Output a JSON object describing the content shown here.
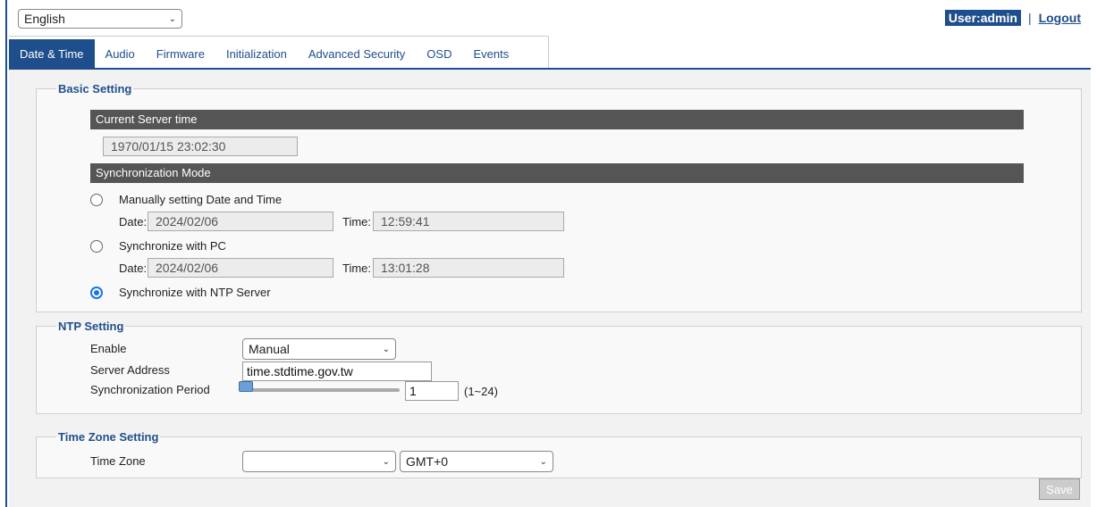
{
  "header": {
    "language": "English",
    "user_label": "User:admin",
    "separator": "|",
    "logout_label": "Logout"
  },
  "tabs": [
    {
      "label": "Date & Time",
      "active": true
    },
    {
      "label": "Audio"
    },
    {
      "label": "Firmware"
    },
    {
      "label": "Initialization"
    },
    {
      "label": "Advanced Security"
    },
    {
      "label": "OSD"
    },
    {
      "label": "Events"
    }
  ],
  "basic": {
    "legend": "Basic Setting",
    "current_server_time_header": "Current Server time",
    "current_server_time": "1970/01/15 23:02:30",
    "sync_mode_header": "Synchronization Mode",
    "manual_label": "Manually setting Date and Time",
    "manual_date_label": "Date:",
    "manual_date": "2024/02/06",
    "manual_time_label": "Time:",
    "manual_time": "12:59:41",
    "pc_label": "Synchronize with PC",
    "pc_date_label": "Date:",
    "pc_date": "2024/02/06",
    "pc_time_label": "Time:",
    "pc_time": "13:01:28",
    "ntp_label": "Synchronize with NTP Server",
    "selected_mode": "ntp"
  },
  "ntp": {
    "legend": "NTP Setting",
    "enable_label": "Enable",
    "enable_value": "Manual",
    "server_label": "Server Address",
    "server_value": "time.stdtime.gov.tw",
    "period_label": "Synchronization Period",
    "period_value": "1",
    "period_range": "(1~24)"
  },
  "timezone": {
    "legend": "Time Zone Setting",
    "label": "Time Zone",
    "region_value": "",
    "offset_value": "GMT+0"
  },
  "save_label": "Save",
  "colors": {
    "accent": "#1f4e8c",
    "section_bar": "#555555",
    "radio_checked": "#1a73e8"
  }
}
